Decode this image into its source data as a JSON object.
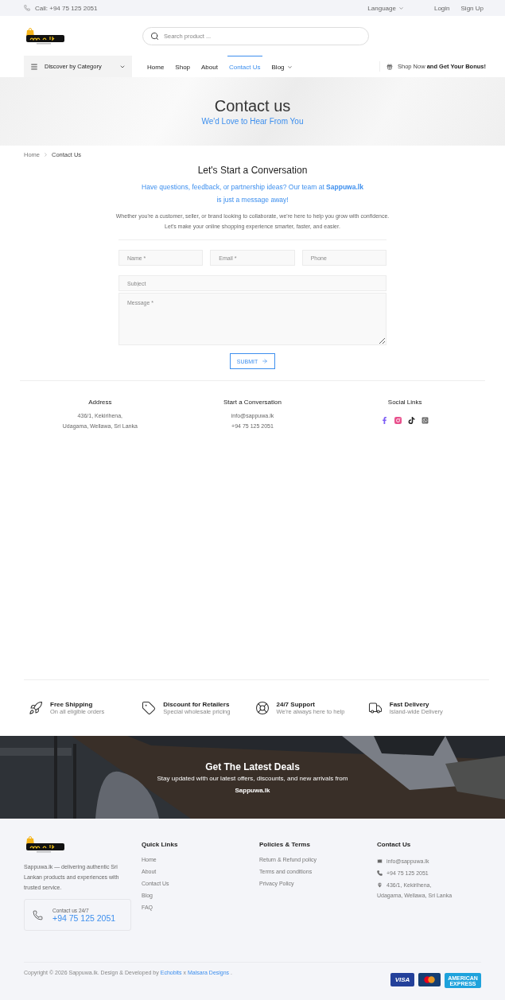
{
  "top_bar": {
    "call": "Call: +94 75 125 2051",
    "language": "Language",
    "links": [
      "Login",
      "Sign Up"
    ]
  },
  "header": {
    "search": {
      "placeholder": "Search product ..."
    }
  },
  "nav": {
    "category": "Discover by Category",
    "items": [
      {
        "label": "Home",
        "selected": false,
        "has_menu": false
      },
      {
        "label": "Shop",
        "selected": false,
        "has_menu": false
      },
      {
        "label": "About",
        "selected": false,
        "has_menu": false
      },
      {
        "label": "Contact Us",
        "selected": true,
        "has_menu": false
      },
      {
        "label": "Blog",
        "selected": false,
        "has_menu": true
      }
    ],
    "promo": {
      "light": "Shop Now",
      "bold": "and Get Your Bonus!"
    }
  },
  "hero": {
    "title": "Contact us",
    "subtitle": "We'd Love to Hear From You"
  },
  "breadcrumb": [
    "Home",
    "Contact Us"
  ],
  "intro": {
    "heading": "Let's Start a Conversation",
    "tagline_1": "Have questions, feedback, or partnership ideas? Our team at **Sappuwa.lk**",
    "tagline_2": "is just a message away!",
    "body": "Whether you're a customer, seller, or brand looking to collaborate, we're here to help you grow with confidence. Let's make your online shopping experience smarter, faster, and easier."
  },
  "form": {
    "fields": [
      {
        "placeholder": "Name *"
      },
      {
        "placeholder": "Email *"
      },
      {
        "placeholder": "Phone"
      }
    ],
    "subject": {
      "placeholder": "Subject"
    },
    "message": {
      "placeholder": "Message *"
    },
    "submit": "SUBMIT"
  },
  "info": {
    "address": {
      "title": "Address",
      "lines": [
        "436/1, Kekirihena,",
        "Udagama, Wellawa, Sri Lanka"
      ]
    },
    "conversation": {
      "title": "Start a Conversation",
      "lines": [
        "info@sappuwa.lk",
        "+94 75 125 2051"
      ]
    },
    "social": {
      "title": "Social Links",
      "items": [
        {
          "kind": "facebook",
          "color": "#7c5cf5"
        },
        {
          "kind": "instagram",
          "color": "#e8508c"
        },
        {
          "kind": "tiktok",
          "color": "#222222"
        },
        {
          "kind": "whatsapp",
          "color": "#666666"
        }
      ]
    }
  },
  "features": [
    {
      "title": "Free Shipping",
      "text": "On all eligible orders"
    },
    {
      "title": "Discount for Retailers",
      "text": "Special wholesale pricing"
    },
    {
      "title": "24/7 Support",
      "text": "We're always here to help"
    },
    {
      "title": "Fast Delivery",
      "text": "Island-wide Delivery"
    }
  ],
  "deals": {
    "kind": "picture",
    "title": "Get The Latest Deals",
    "text": "Stay updated with our latest offers, discounts, and new arrivals from",
    "brand": "Sappuwa.lk"
  },
  "footer": {
    "about": "Sappuwa.lk — delivering authentic Sri Lankan products and experiences with trusted service.",
    "contact_card": {
      "label": "Contact us 24/7",
      "phone": "+94 75 125 2051"
    },
    "columns": [
      {
        "title": "Quick Links",
        "links": [
          "Home",
          "About",
          "Contact Us",
          "Blog",
          "FAQ"
        ]
      },
      {
        "title": "Policies & Terms",
        "links": [
          "Return & Refund policy",
          "Terms and conditions",
          "Privacy Policy"
        ]
      }
    ],
    "contact": {
      "title": "Contact Us",
      "email": "info@sappuwa.lk",
      "phone": "+94 75 125 2051",
      "address": [
        "436/1, Kekirihena,",
        "Udagama, Wellawa, Sri Lanka"
      ]
    },
    "copyright": {
      "text": "Copyright © 2026 Sappuwa.lk. Design & Developed by",
      "link_1": "Echobits",
      "sep": "x",
      "link_2": "Malsara Designs",
      "end": "."
    },
    "payments": [
      {
        "kind": "visa",
        "label": "VISA"
      },
      {
        "kind": "mastercard"
      },
      {
        "kind": "amex",
        "label": "AMERICAN EXPRESS"
      }
    ]
  }
}
